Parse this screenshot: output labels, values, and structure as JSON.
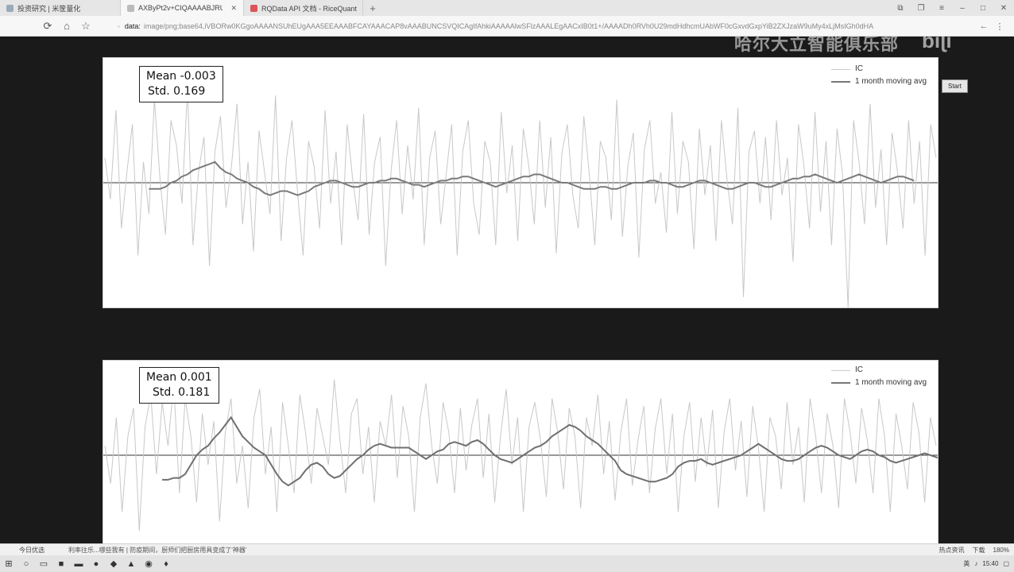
{
  "tabs": [
    {
      "label": "投资研究 | 米筐量化",
      "active": false
    },
    {
      "label": "AXByPt2v+CIQAAAABJRU",
      "active": true
    },
    {
      "label": "RQData API 文档 - RiceQuant",
      "active": false
    }
  ],
  "address": {
    "scheme": "data:",
    "url": "image/png;base64,iVBORw0KGgoAAAANSUhEUgAAA5EEAAABFCAYAAACAP8vAAABUNCSVQICAgIfAhkiAAAAAlwSFlzAAALEgAACxIB0t1+/AAAADh0RVh0U29mdHdhcmUAbWF0cGxvdGxpYiB2ZXJzaW9uMy4xLjMsIGh0dHA"
  },
  "watermark": {
    "text": "哈尔大立智能俱乐部",
    "logo": "bilibili"
  },
  "start_button": "Start",
  "plots": [
    {
      "stats": {
        "mean": "Mean -0.003",
        "std": "Std. 0.169"
      },
      "legend": [
        "IC",
        "1 month moving avg"
      ],
      "chart_data": {
        "type": "line",
        "title": "",
        "xlabel": "",
        "ylabel": "",
        "ylim": [
          -0.6,
          0.6
        ],
        "grid": false,
        "legend_position": "top-right",
        "zero_line": 0,
        "series": [
          {
            "name": "IC",
            "color": "#c8c8c8",
            "values": [
              0.12,
              -0.08,
              0.35,
              -0.22,
              0.05,
              0.28,
              -0.35,
              0.1,
              -0.15,
              0.4,
              0.02,
              -0.25,
              0.3,
              0.18,
              -0.1,
              0.45,
              -0.3,
              0.05,
              0.22,
              -0.4,
              0.15,
              0.32,
              -0.12,
              0.08,
              0.38,
              -0.2,
              0.1,
              -0.33,
              0.25,
              0.05,
              -0.15,
              0.42,
              -0.28,
              0.12,
              0.3,
              -0.05,
              -0.35,
              0.2,
              0.08,
              -0.22,
              0.35,
              -0.1,
              0.15,
              -0.3,
              0.28,
              0.02,
              -0.18,
              0.33,
              -0.25,
              0.1,
              0.22,
              -0.4,
              0.06,
              0.3,
              -0.15,
              0.18,
              -0.08,
              0.36,
              -0.3,
              0.12,
              0.25,
              -0.2,
              0.04,
              0.28,
              -0.35,
              0.15,
              0.3,
              -0.1,
              -0.25,
              0.2,
              0.1,
              -0.3,
              0.34,
              -0.05,
              0.18,
              -0.28,
              0.26,
              0.08,
              -0.2,
              0.3,
              -0.12,
              0.22,
              -0.34,
              0.14,
              0.28,
              -0.06,
              -0.22,
              0.32,
              0.04,
              -0.3,
              0.2,
              0.12,
              -0.18,
              0.4,
              -0.26,
              0.08,
              0.24,
              -0.36,
              0.16,
              0.3,
              -0.1,
              0.05,
              -0.24,
              0.34,
              -0.15,
              0.2,
              0.1,
              -0.32,
              0.26,
              -0.06,
              0.18,
              -0.28,
              0.3,
              0.02,
              -0.2,
              0.36,
              -0.55,
              0.15,
              0.25,
              -0.1,
              0.22,
              -0.18,
              0.3,
              -0.06,
              0.12,
              -0.38,
              0.28,
              0.08,
              -0.22,
              0.34,
              -0.14,
              0.2,
              -0.3,
              0.26,
              0.04,
              -0.6,
              0.3,
              0.1,
              -0.2,
              0.38,
              -0.12,
              0.16,
              -0.3,
              0.24,
              0.05,
              -0.22,
              0.3,
              -0.1,
              0.2,
              -0.35,
              0.28,
              0.12
            ]
          },
          {
            "name": "1 month moving avg",
            "color": "#7a7a7a",
            "values": [
              null,
              null,
              null,
              null,
              null,
              null,
              null,
              null,
              -0.03,
              -0.03,
              -0.03,
              -0.02,
              0.0,
              0.01,
              0.03,
              0.04,
              0.06,
              0.07,
              0.08,
              0.09,
              0.1,
              0.07,
              0.05,
              0.04,
              0.02,
              0.01,
              0.0,
              -0.02,
              -0.03,
              -0.05,
              -0.06,
              -0.05,
              -0.04,
              -0.04,
              -0.05,
              -0.06,
              -0.05,
              -0.04,
              -0.02,
              -0.01,
              0.0,
              0.01,
              0.01,
              0.0,
              -0.01,
              -0.02,
              -0.02,
              -0.01,
              0.0,
              0.0,
              0.01,
              0.01,
              0.02,
              0.02,
              0.01,
              0.0,
              -0.01,
              -0.01,
              -0.02,
              -0.01,
              0.0,
              0.01,
              0.01,
              0.02,
              0.02,
              0.03,
              0.03,
              0.02,
              0.01,
              0.0,
              -0.01,
              -0.02,
              -0.01,
              0.0,
              0.01,
              0.02,
              0.03,
              0.03,
              0.04,
              0.04,
              0.03,
              0.02,
              0.01,
              0.0,
              0.0,
              -0.01,
              -0.02,
              -0.03,
              -0.03,
              -0.03,
              -0.02,
              -0.02,
              -0.03,
              -0.03,
              -0.02,
              -0.01,
              0.0,
              0.0,
              0.0,
              0.01,
              0.01,
              0.0,
              0.0,
              -0.01,
              -0.02,
              -0.02,
              -0.01,
              0.0,
              0.01,
              0.01,
              0.0,
              -0.01,
              -0.02,
              -0.03,
              -0.03,
              -0.02,
              -0.01,
              0.0,
              0.0,
              -0.01,
              -0.02,
              -0.02,
              -0.01,
              0.0,
              0.01,
              0.02,
              0.02,
              0.03,
              0.03,
              0.04,
              0.03,
              0.02,
              0.01,
              0.0,
              0.01,
              0.02,
              0.03,
              0.04,
              0.03,
              0.02,
              0.01,
              0.0,
              0.01,
              0.02,
              0.03,
              0.03,
              0.02,
              0.01
            ]
          }
        ]
      }
    },
    {
      "stats": {
        "mean": "Mean 0.001",
        "std": "Std. 0.181"
      },
      "legend": [
        "IC",
        "1 month moving avg"
      ],
      "chart_data": {
        "type": "line",
        "title": "",
        "xlabel": "",
        "ylabel": "",
        "ylim": [
          -0.5,
          0.5
        ],
        "grid": false,
        "legend_position": "top-right",
        "zero_line": 0,
        "series": [
          {
            "name": "IC",
            "color": "#c8c8c8",
            "values": [
              0.05,
              -0.15,
              0.2,
              -0.3,
              0.1,
              0.25,
              -0.4,
              0.15,
              0.32,
              -0.1,
              0.28,
              0.05,
              0.38,
              -0.2,
              0.3,
              0.1,
              -0.25,
              0.22,
              -0.05,
              0.18,
              -0.35,
              0.12,
              0.3,
              -0.15,
              0.05,
              -0.28,
              0.2,
              0.35,
              -0.1,
              0.15,
              -0.3,
              0.28,
              0.05,
              -0.2,
              0.32,
              0.12,
              -0.15,
              0.25,
              0.1,
              -0.05,
              0.4,
              0.08,
              -0.2,
              0.22,
              0.3,
              -0.1,
              0.15,
              -0.25,
              0.18,
              0.05,
              0.32,
              -0.12,
              0.26,
              0.1,
              -0.3,
              0.2,
              0.38,
              0.05,
              -0.15,
              0.28,
              0.12,
              -0.2,
              0.25,
              -0.08,
              0.16,
              0.3,
              -0.12,
              0.22,
              -0.25,
              0.1,
              0.35,
              -0.05,
              0.2,
              -0.3,
              0.15,
              0.28,
              0.08,
              -0.22,
              0.3,
              0.12,
              -0.18,
              0.25,
              0.1,
              -0.28,
              0.2,
              0.05,
              0.32,
              -0.1,
              0.18,
              -0.24,
              0.12,
              0.3,
              -0.16,
              0.08,
              0.26,
              -0.2,
              0.14,
              0.3,
              -0.1,
              0.22,
              -0.3,
              0.1,
              0.28,
              -0.14,
              0.2,
              -0.06,
              0.24,
              -0.28,
              0.12,
              0.3,
              -0.08,
              0.18,
              -0.22,
              0.26,
              0.04,
              -0.3,
              0.2,
              0.1,
              -0.18,
              0.28,
              -0.05,
              0.15,
              -0.25,
              0.3,
              0.1,
              -0.2,
              0.22,
              0.05,
              -0.28,
              0.3,
              0.12,
              -0.15,
              0.25,
              0.08,
              -0.2,
              0.3,
              0.1,
              -0.3,
              0.22,
              0.05,
              -0.18,
              0.28,
              0.12,
              -0.25,
              0.2,
              0.05
            ]
          },
          {
            "name": "1 month moving avg",
            "color": "#6f6f6f",
            "values": [
              null,
              null,
              null,
              null,
              null,
              null,
              null,
              null,
              null,
              null,
              -0.13,
              -0.13,
              -0.12,
              -0.12,
              -0.1,
              -0.05,
              0.0,
              0.03,
              0.05,
              0.09,
              0.12,
              0.16,
              0.2,
              0.15,
              0.1,
              0.07,
              0.04,
              0.02,
              0.0,
              -0.05,
              -0.1,
              -0.14,
              -0.16,
              -0.14,
              -0.12,
              -0.08,
              -0.05,
              -0.04,
              -0.06,
              -0.1,
              -0.12,
              -0.11,
              -0.08,
              -0.05,
              -0.02,
              0.0,
              0.03,
              0.05,
              0.06,
              0.05,
              0.04,
              0.04,
              0.04,
              0.04,
              0.02,
              0.0,
              -0.02,
              0.0,
              0.02,
              0.03,
              0.06,
              0.07,
              0.06,
              0.05,
              0.07,
              0.08,
              0.06,
              0.03,
              0.0,
              -0.02,
              -0.03,
              -0.04,
              -0.02,
              0.0,
              0.02,
              0.04,
              0.05,
              0.07,
              0.1,
              0.12,
              0.14,
              0.16,
              0.15,
              0.13,
              0.1,
              0.08,
              0.06,
              0.03,
              0.0,
              -0.03,
              -0.08,
              -0.1,
              -0.11,
              -0.12,
              -0.13,
              -0.14,
              -0.14,
              -0.13,
              -0.12,
              -0.1,
              -0.06,
              -0.04,
              -0.03,
              -0.03,
              -0.02,
              -0.04,
              -0.05,
              -0.04,
              -0.03,
              -0.02,
              -0.01,
              0.0,
              0.02,
              0.04,
              0.06,
              0.04,
              0.02,
              0.0,
              -0.02,
              -0.03,
              -0.03,
              -0.02,
              0.0,
              0.02,
              0.04,
              0.05,
              0.04,
              0.02,
              0.0,
              -0.01,
              -0.02,
              0.0,
              0.02,
              0.03,
              0.02,
              0.0,
              -0.01,
              -0.03,
              -0.04,
              -0.03,
              -0.02,
              -0.01,
              0.0,
              0.01,
              0.0,
              -0.01,
              -0.02,
              -0.03
            ]
          }
        ]
      }
    }
  ],
  "statusbar": {
    "left": "今日优选",
    "news": "利率往乐...哪些我有 | 防疫期间，厨师们把厨房用具变成了'神器'",
    "right_items": [
      "热点资讯",
      "下载",
      "180%"
    ]
  },
  "taskbar": {
    "time": "15:40",
    "lang": "英"
  }
}
